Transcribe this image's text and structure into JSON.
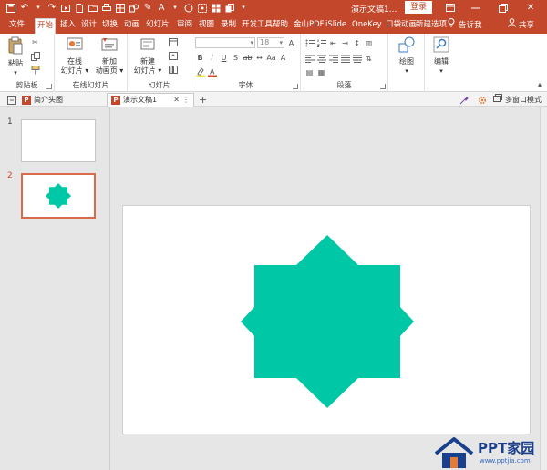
{
  "window": {
    "title": "演示文稿1...",
    "login_label": "登录",
    "controls": [
      "ribbon-display-icon",
      "minimize-icon",
      "restore-icon",
      "close-icon"
    ]
  },
  "quick_access": [
    "save-icon",
    "undo-icon",
    "redo-icon",
    "start-from-beginning-icon",
    "new-icon",
    "open-icon",
    "save-as-icon",
    "shapes-icon",
    "pen-icon",
    "font-color-icon",
    "circle-icon",
    "screenshot-icon",
    "table-icon",
    "more-icon"
  ],
  "tabs": [
    {
      "label": "文件",
      "active": false
    },
    {
      "label": "开始",
      "active": true
    },
    {
      "label": "插入",
      "active": false
    },
    {
      "label": "设计",
      "active": false
    },
    {
      "label": "切换",
      "active": false
    },
    {
      "label": "动画",
      "active": false
    },
    {
      "label": "幻灯片",
      "active": false
    },
    {
      "label": "审阅",
      "active": false
    },
    {
      "label": "视图",
      "active": false
    },
    {
      "label": "录制",
      "active": false
    },
    {
      "label": "开发工具",
      "active": false
    },
    {
      "label": "帮助",
      "active": false
    },
    {
      "label": "金山PDF",
      "active": false
    },
    {
      "label": "iSlide",
      "active": false
    },
    {
      "label": "OneKey",
      "active": false
    },
    {
      "label": "口袋动画",
      "active": false
    },
    {
      "label": "新建选项",
      "active": false
    }
  ],
  "tell_me": "告诉我",
  "share": "共享",
  "ribbon": {
    "clipboard": {
      "paste": "粘贴",
      "label": "剪贴板"
    },
    "online_slides": {
      "btn1_line1": "在线",
      "btn1_line2": "幻灯片 ▾",
      "btn2_line1": "新加",
      "btn2_line2": "动画页 ▾",
      "label": "在线幻灯片"
    },
    "slides": {
      "new_line1": "新建",
      "new_line2": "幻灯片 ▾",
      "label": "幻灯片"
    },
    "font": {
      "size": "18",
      "label": "字体"
    },
    "paragraph": {
      "label": "段落"
    },
    "drawing": {
      "label": "绘图"
    },
    "editing": {
      "label": "编辑"
    }
  },
  "doc_tabs": [
    {
      "label": "简介头图",
      "active": false
    },
    {
      "label": "演示文稿1",
      "active": true
    }
  ],
  "doc_tab_new": "+",
  "multi_window": "多窗口模式",
  "slides": [
    {
      "number": "1",
      "selected": false
    },
    {
      "number": "2",
      "selected": true
    }
  ],
  "shape": {
    "type": "8-point star",
    "fill": "#00c8a6"
  },
  "watermark": {
    "title": "PPT家园",
    "subtitle": "www.pptjia.com"
  },
  "colors": {
    "accent": "#c2472b",
    "selection": "#d96a4a"
  }
}
